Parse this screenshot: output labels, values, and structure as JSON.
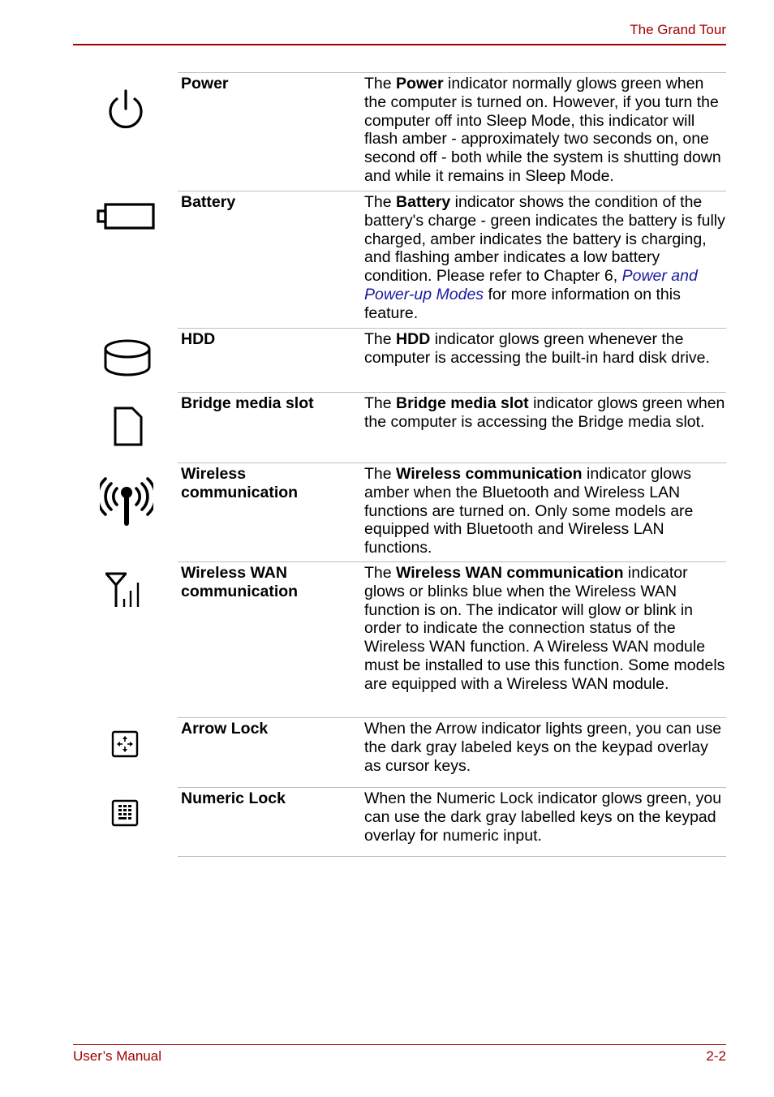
{
  "header": {
    "title": "The Grand Tour"
  },
  "footer": {
    "left": "User’s Manual",
    "right": "2-2"
  },
  "colors": {
    "accent": "#a00000",
    "link": "#1a1aa0",
    "rule": "#bdbdbd"
  },
  "rows": [
    {
      "icon": "power-icon",
      "term": "Power",
      "desc_pre": "The ",
      "desc_bold": "Power",
      "desc_post": " indicator normally glows green when the computer is turned on. However, if you turn the computer off into Sleep Mode, this indicator will flash amber - approximately two seconds on, one second off - both while the system is shutting down and while it remains in Sleep Mode."
    },
    {
      "icon": "battery-icon",
      "term": "Battery",
      "desc_pre": "The ",
      "desc_bold": "Battery",
      "desc_post": " indicator shows the condition of the battery's charge - green indicates the battery is fully charged, amber indicates the battery is charging, and flashing amber indicates a low battery condition. Please refer to Chapter 6, ",
      "desc_link": "Power and Power-up Modes",
      "desc_tail": " for more information on this feature."
    },
    {
      "icon": "hdd-icon",
      "term": "HDD",
      "desc_pre": "The ",
      "desc_bold": "HDD",
      "desc_post": " indicator glows green whenever the computer is accessing the built-in hard disk drive."
    },
    {
      "icon": "media-card-icon",
      "term": "Bridge media slot",
      "desc_pre": "The ",
      "desc_bold": "Bridge media slot",
      "desc_post": " indicator glows green when the computer is accessing the Bridge media slot."
    },
    {
      "icon": "wireless-antenna-icon",
      "term": "Wireless communication",
      "desc_pre": "The ",
      "desc_bold": "Wireless communication",
      "desc_post": " indicator glows amber when the Bluetooth and Wireless LAN functions are turned on. Only some models are equipped with Bluetooth and Wireless LAN functions."
    },
    {
      "icon": "wan-signal-icon",
      "term": "Wireless WAN communication",
      "desc_pre": "The ",
      "desc_bold": "Wireless WAN communication",
      "desc_post": " indicator glows or blinks blue when the Wireless WAN function is on. The indicator will glow or blink in order to indicate the connection status of the Wireless WAN function. A Wireless WAN module must be installed to use this function. Some models are equipped with a Wireless WAN module."
    },
    {
      "icon": "arrow-lock-icon",
      "term": "Arrow Lock",
      "desc_pre": "When the Arrow indicator lights green, you can use the dark gray labeled keys on the keypad overlay as cursor keys."
    },
    {
      "icon": "numeric-lock-icon",
      "term": "Numeric Lock",
      "desc_pre": "When the Numeric Lock indicator glows green, you can use the dark gray labelled keys on the keypad overlay for numeric input."
    }
  ]
}
